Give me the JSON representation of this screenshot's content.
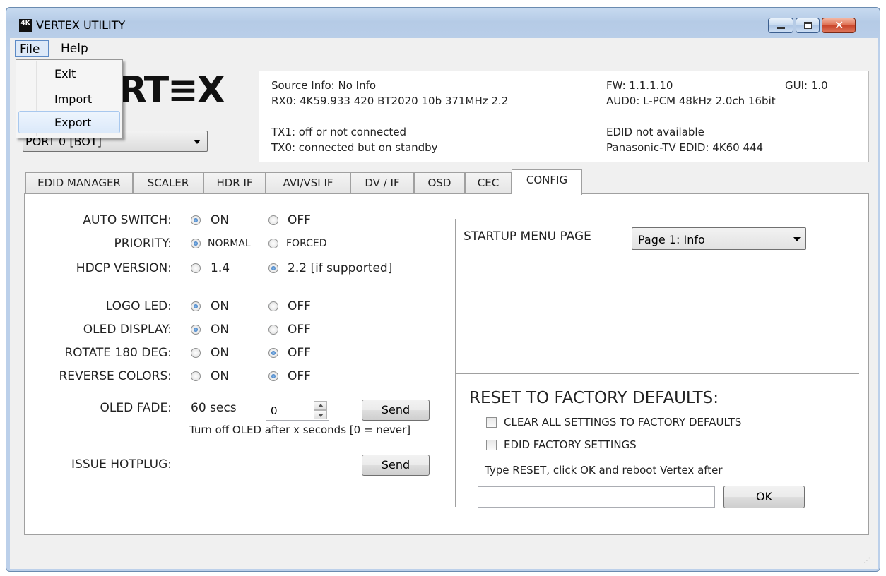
{
  "window": {
    "title": "VERTEX UTILITY",
    "app_icon": "4K"
  },
  "menubar": {
    "file": "File",
    "help": "Help"
  },
  "file_menu": {
    "items": [
      "Exit",
      "Import",
      "Export"
    ]
  },
  "logo": {
    "text": "RT≡X"
  },
  "port": {
    "selected": "PORT 0 [BOT]"
  },
  "info": {
    "source_info": "Source Info: No Info",
    "rx0": "RX0: 4K59.933 420 BT2020 10b 371MHz 2.2",
    "tx1": "TX1: off or not connected",
    "tx0": "TX0: connected but on standby",
    "fw": "FW: 1.1.1.10",
    "gui": "GUI: 1.0",
    "aud0": "AUD0: L-PCM 48kHz 2.0ch 16bit",
    "edid": "EDID not available",
    "sink_edid": "Panasonic-TV EDID: 4K60 444"
  },
  "tabs": [
    "EDID MANAGER",
    "SCALER",
    "HDR IF",
    "AVI/VSI IF",
    "DV / IF",
    "OSD",
    "CEC",
    "CONFIG"
  ],
  "config": {
    "auto_switch": {
      "label": "AUTO SWITCH:",
      "on": "ON",
      "off": "OFF",
      "selected": "on"
    },
    "priority": {
      "label": "PRIORITY:",
      "normal": "NORMAL",
      "forced": "FORCED",
      "selected": "normal"
    },
    "hdcp": {
      "label": "HDCP VERSION:",
      "v14": "1.4",
      "v22": "2.2 [if supported]",
      "selected": "2.2"
    },
    "logo_led": {
      "label": "LOGO LED:",
      "on": "ON",
      "off": "OFF",
      "selected": "on"
    },
    "oled_display": {
      "label": "OLED DISPLAY:",
      "on": "ON",
      "off": "OFF",
      "selected": "on"
    },
    "rotate": {
      "label": "ROTATE 180 DEG:",
      "on": "ON",
      "off": "OFF",
      "selected": "off"
    },
    "reverse": {
      "label": "REVERSE COLORS:",
      "on": "ON",
      "off": "OFF",
      "selected": "off"
    },
    "oled_fade": {
      "label": "OLED FADE:",
      "value_text": "60 secs",
      "spinner_value": "0",
      "send": "Send",
      "hint": "Turn off OLED after x seconds [0 = never]"
    },
    "hotplug": {
      "label": "ISSUE HOTPLUG:",
      "send": "Send"
    },
    "startup": {
      "label": "STARTUP MENU PAGE",
      "selected": "Page 1: Info"
    },
    "reset": {
      "title": "RESET TO FACTORY DEFAULTS:",
      "clear_all": "CLEAR ALL SETTINGS TO FACTORY DEFAULTS",
      "edid_factory": "EDID FACTORY SETTINGS",
      "instruction": "Type RESET, click OK and reboot Vertex after",
      "input_value": "",
      "ok": "OK"
    }
  }
}
